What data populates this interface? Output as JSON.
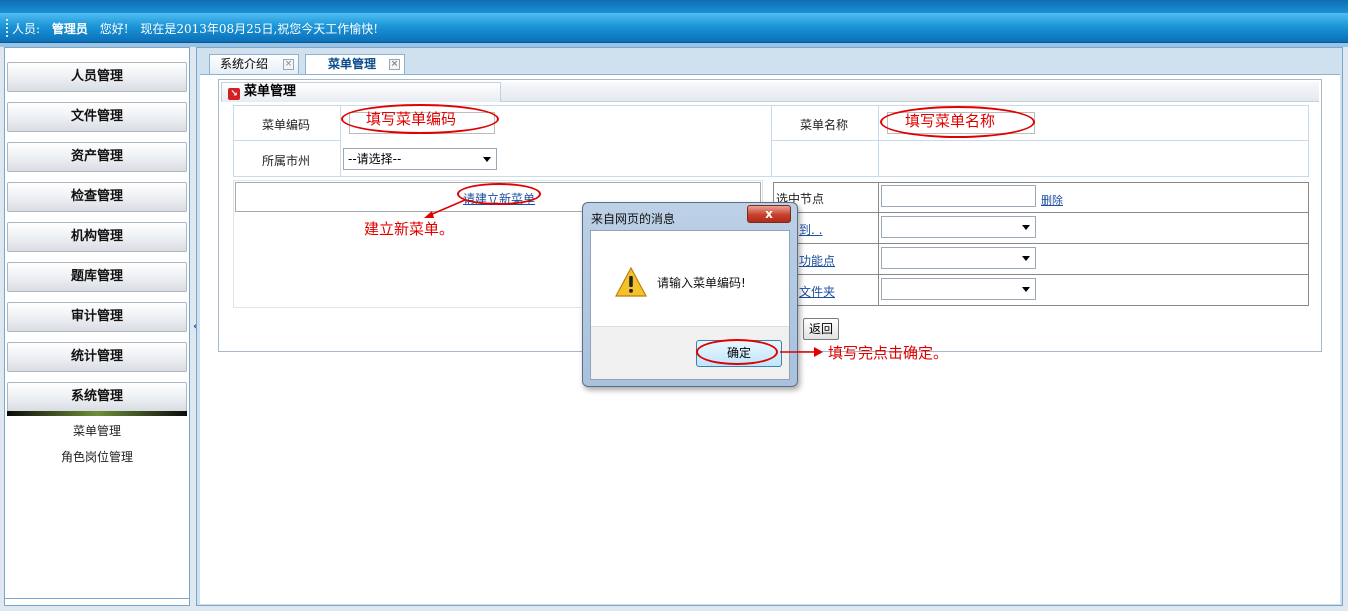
{
  "header": {
    "role_label": "人员:",
    "user_name": "管理员",
    "greeting": "您好!",
    "date_message": "现在是2013年08月25日,祝您今天工作愉快!"
  },
  "sidebar": {
    "items": [
      {
        "label": "人员管理"
      },
      {
        "label": "文件管理"
      },
      {
        "label": "资产管理"
      },
      {
        "label": "检查管理"
      },
      {
        "label": "机构管理"
      },
      {
        "label": "题库管理"
      },
      {
        "label": "审计管理"
      },
      {
        "label": "统计管理"
      },
      {
        "label": "系统管理"
      }
    ],
    "submenu": [
      {
        "label": "菜单管理"
      },
      {
        "label": "角色岗位管理"
      }
    ],
    "collapse_glyph": "«"
  },
  "tabs": [
    {
      "label": "系统介绍",
      "active": false
    },
    {
      "label": "菜单管理",
      "active": true
    }
  ],
  "tab_close_glyph": "×",
  "panel": {
    "title": "菜单管理",
    "form": {
      "menu_code_label": "菜单编码",
      "menu_name_label": "菜单名称",
      "city_label": "所属市州",
      "city_select_value": "--请选择--"
    },
    "tree": {
      "create_link": "请建立新菜单"
    },
    "detail": {
      "selected_node_label": "选中节点",
      "delete_link": "删除",
      "move_to_link": "到. .",
      "function_point_link": "功能点",
      "folder_link": "文件夹"
    },
    "back_button": "返回"
  },
  "annotations": {
    "fill_code": "填写菜单编码",
    "fill_name": "填写菜单名称",
    "create_menu": "建立新菜单。",
    "click_ok": "填写完点击确定。"
  },
  "dialog": {
    "title": "来自网页的消息",
    "close_glyph": "x",
    "message": "请输入菜单编码!",
    "ok_button": "确定"
  },
  "colors": {
    "annotation": "#e00000",
    "header_blue": "#1c95d8",
    "link_blue": "#1b4fa0"
  }
}
